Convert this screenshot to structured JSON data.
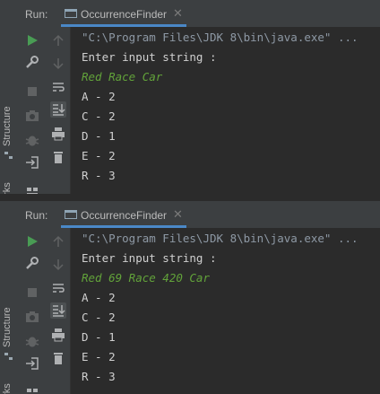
{
  "colors": {
    "input_text": "#62a33a",
    "output_text": "#d0d0d0",
    "tab_underline": "#4a88c7",
    "run_icon": "#499c54"
  },
  "sidebar": {
    "structure_label": "Structure",
    "bookmarks_label": "arks"
  },
  "panels": [
    {
      "run_label": "Run:",
      "tab_label": "OccurrenceFinder",
      "command": "\"C:\\Program Files\\JDK 8\\bin\\java.exe\" ...",
      "prompt": "Enter input string :",
      "input": "Red Race Car",
      "results": [
        "A - 2",
        "C - 2",
        "D - 1",
        "E - 2",
        "R - 3"
      ]
    },
    {
      "run_label": "Run:",
      "tab_label": "OccurrenceFinder",
      "command": "\"C:\\Program Files\\JDK 8\\bin\\java.exe\" ...",
      "prompt": "Enter input string :",
      "input": "Red 69 Race 420 Car",
      "results": [
        "A - 2",
        "C - 2",
        "D - 1",
        "E - 2",
        "R - 3"
      ]
    }
  ],
  "toolbar_icons": [
    "run-icon",
    "wrench-icon",
    "stop-icon",
    "camera-icon",
    "bug-icon",
    "login-icon",
    "layout-icon",
    "up-arrow-icon",
    "down-arrow-icon",
    "soft-wrap-icon",
    "scroll-to-end-icon",
    "print-icon",
    "trash-icon"
  ]
}
